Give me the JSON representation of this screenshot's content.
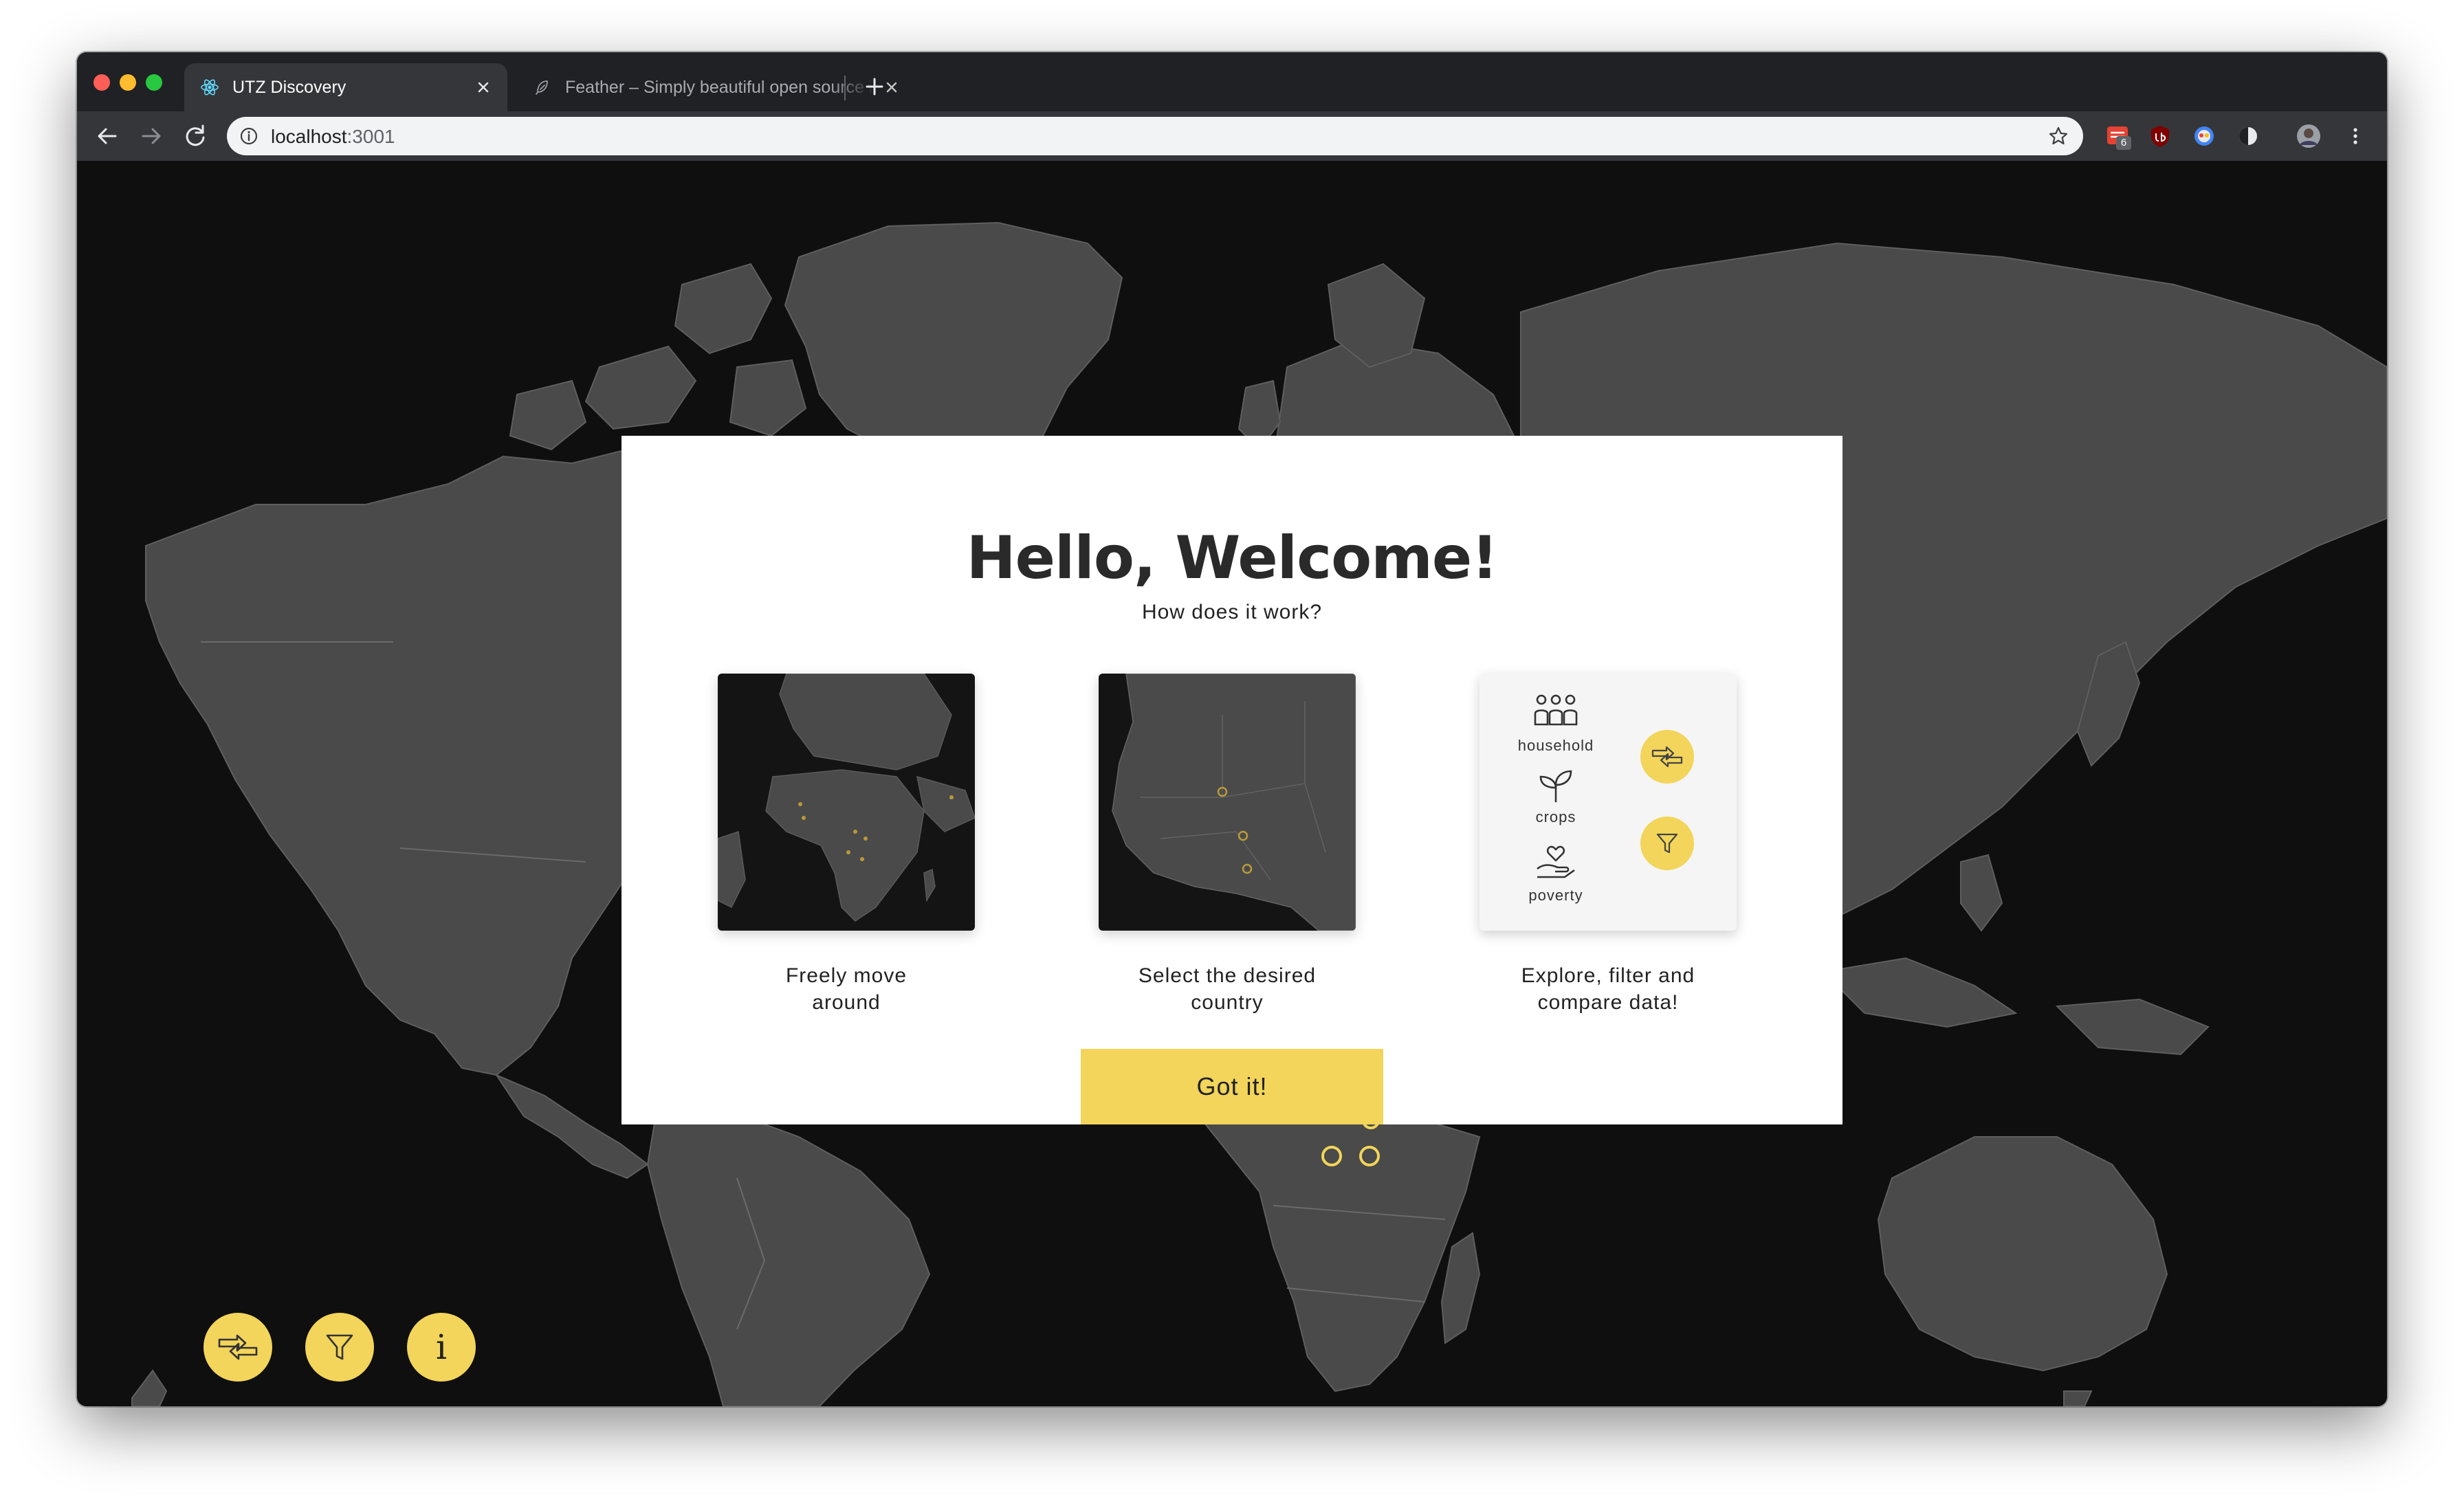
{
  "browser": {
    "tabs": [
      {
        "title": "UTZ Discovery",
        "active": true,
        "favicon": "react-icon"
      },
      {
        "title": "Feather – Simply beautiful open source icons",
        "active": false,
        "favicon": "feather-icon"
      }
    ],
    "url_host": "localhost",
    "url_port": ":3001",
    "extension_badge": "6",
    "extensions": [
      "todoist-icon",
      "ublock-icon",
      "devtools-icon",
      "dark-reader-icon",
      "profile-avatar"
    ]
  },
  "modal": {
    "title": "Hello, Welcome!",
    "subtitle": "How does it work?",
    "steps": [
      {
        "label_line1": "Freely move",
        "label_line2": "around"
      },
      {
        "label_line1": "Select the desired",
        "label_line2": "country"
      },
      {
        "label_line1": "Explore, filter and",
        "label_line2": "compare data!"
      }
    ],
    "categories": [
      {
        "label": "household",
        "icon": "users-icon"
      },
      {
        "label": "crops",
        "icon": "sprout-icon"
      },
      {
        "label": "poverty",
        "icon": "hand-heart-icon"
      }
    ],
    "button_label": "Got it!"
  },
  "map_controls": [
    {
      "name": "compare-icon"
    },
    {
      "name": "filter-icon"
    },
    {
      "name": "info-icon",
      "label": "i"
    }
  ],
  "colors": {
    "accent": "#f2d55a",
    "map_land": "#4a4a4a",
    "map_ocean": "#0f0f0f",
    "browser_frame": "#202124"
  }
}
